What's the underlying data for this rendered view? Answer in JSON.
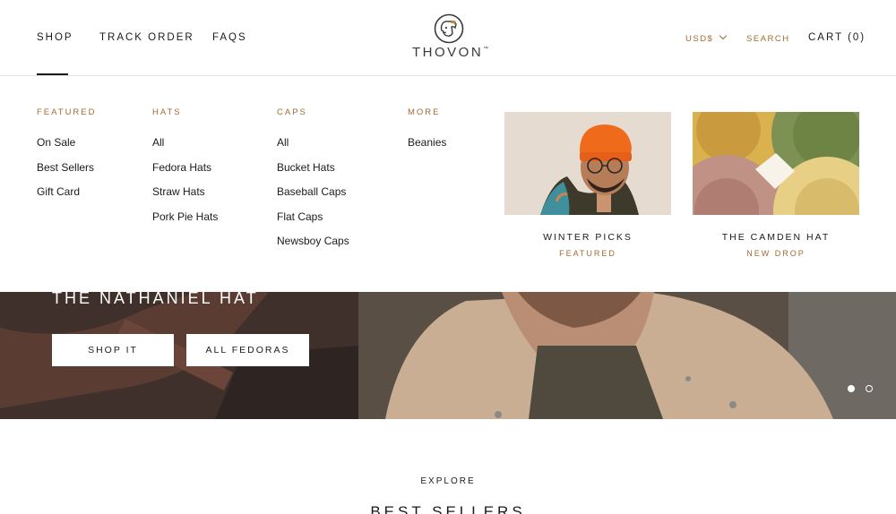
{
  "header": {
    "nav": [
      "SHOP",
      "TRACK ORDER",
      "FAQS"
    ],
    "logo_text": "THOVON",
    "logo_tm": "™",
    "currency": "USD$",
    "search": "SEARCH",
    "cart": "CART (0)"
  },
  "menu": {
    "featured": {
      "title": "FEATURED",
      "items": [
        "On Sale",
        "Best Sellers",
        "Gift Card"
      ]
    },
    "hats": {
      "title": "HATS",
      "items": [
        "All",
        "Fedora Hats",
        "Straw Hats",
        "Pork Pie Hats"
      ]
    },
    "caps": {
      "title": "CAPS",
      "items": [
        "All",
        "Bucket Hats",
        "Baseball Caps",
        "Flat Caps",
        "Newsboy Caps"
      ]
    },
    "more": {
      "title": "MORE",
      "items": [
        "Beanies"
      ]
    },
    "promos": [
      {
        "title": "WINTER PICKS",
        "subtitle": "FEATURED"
      },
      {
        "title": "THE CAMDEN HAT",
        "subtitle": "NEW DROP"
      }
    ]
  },
  "hero": {
    "title": "THE NATHANIEL HAT",
    "buttons": [
      "SHOP IT",
      "ALL FEDORAS"
    ]
  },
  "section": {
    "eyebrow": "EXPLORE",
    "title": "BEST SELLERS"
  },
  "colors": {
    "accent": "#a06b34",
    "text": "#1c1b1b"
  }
}
